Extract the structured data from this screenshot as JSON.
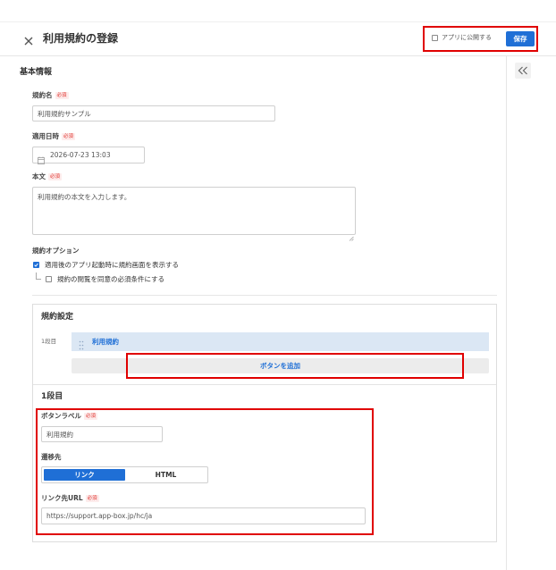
{
  "header": {
    "title": "利用規約の登録",
    "publish_label": "アプリに公開する",
    "publish_checked": false,
    "save_label": "保存"
  },
  "required_badge": "必須",
  "basic": {
    "heading": "基本情報",
    "name_label": "規約名",
    "name_value": "利用規約サンプル",
    "date_label": "適用日時",
    "date_value": "2026-07-23 13:03",
    "body_label": "本文",
    "body_value": "利用規約の本文を入力します。",
    "options_label": "規約オプション",
    "option_show": {
      "label": "適用後のアプリ起動時に規約画面を表示する",
      "checked": true
    },
    "option_require": {
      "label": "規約の閲覧を同意の必須条件にする",
      "checked": false
    }
  },
  "settings": {
    "heading": "規約設定",
    "rows": [
      {
        "label": "1段目",
        "buttons": [
          "利用規約"
        ]
      }
    ],
    "add_button_label": "ボタンを追加",
    "detail": {
      "heading": "1段目",
      "button_label_label": "ボタンラベル",
      "button_label_value": "利用規約",
      "destination_label": "遷移先",
      "destination_options": [
        "リンク",
        "HTML"
      ],
      "destination_selected": "リンク",
      "url_label": "リンク先URL",
      "url_value": "https://support.app-box.jp/hc/ja"
    }
  },
  "icons": {
    "close": "close-icon",
    "collapse": "double-chevron-left-icon",
    "calendar": "calendar-icon",
    "check": "check-icon",
    "drag": "drag-handle-icon",
    "resize": "resize-grip-icon"
  },
  "colors": {
    "primary": "#1f6fd6",
    "annotation_highlight": "#e00000",
    "required": "#e0312b",
    "row_highlight": "#dbe7f4"
  }
}
